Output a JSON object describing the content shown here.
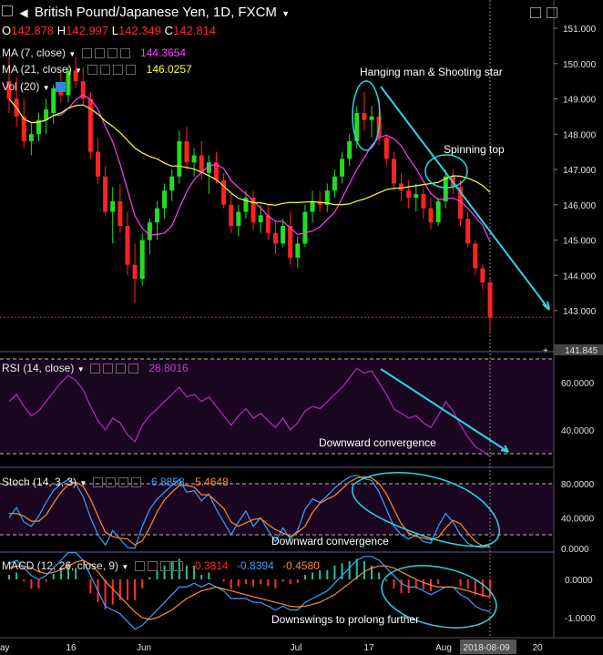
{
  "header": {
    "title": "British Pound/Japanese Yen, 1D, FXCM",
    "ohlc": {
      "o_label": "O",
      "o": "142.878",
      "h_label": "H",
      "h": "142.997",
      "l_label": "L",
      "l": "142.349",
      "c_label": "C",
      "c": "142.814"
    },
    "ma7": {
      "label": "MA (7, close)",
      "value": "144.3654"
    },
    "ma21": {
      "label": "MA (21, close)",
      "value": "146.0257"
    },
    "vol": {
      "label": "Vol (20)"
    }
  },
  "rsi": {
    "label": "RSI (14, close)",
    "value": "28.8016"
  },
  "stoch": {
    "label": "Stoch (14, 3, 3)",
    "k": "6.8858",
    "d": "5.4648"
  },
  "macd": {
    "label": "MACD (12, 26, close, 9)",
    "hist": "-0.3814",
    "macd": "-0.8394",
    "signal": "-0.4580"
  },
  "annotations": {
    "a1": "Hanging man & Shooting star",
    "a2": "Spinning top",
    "a3": "Downward convergence",
    "a4": "Downward convergence",
    "a5": "Downswings to prolong further"
  },
  "price_axis": {
    "ticks": [
      "151.000",
      "150.000",
      "149.000",
      "148.000",
      "147.000",
      "146.000",
      "145.000",
      "144.000",
      "143.000"
    ],
    "last": "141.845"
  },
  "rsi_axis": {
    "ticks": [
      "60.0000",
      "40.0000"
    ]
  },
  "stoch_axis": {
    "ticks": [
      "80.0000",
      "40.0000",
      "0.0000"
    ]
  },
  "macd_axis": {
    "ticks": [
      "0.0000",
      "-1.0000"
    ]
  },
  "time_axis": {
    "ticks": [
      "ay",
      "16",
      "Jun",
      "Jul",
      "17",
      "Aug",
      "2018-08-09",
      "20"
    ]
  },
  "colors": {
    "up": "#22dd22",
    "down": "#ff2222",
    "ma7": "#ff40ff",
    "ma21": "#ffff40",
    "rsi": "#b030c0",
    "stoch_k": "#3aa0ff",
    "stoch_d": "#ff8a30",
    "macd": "#3aa0ff",
    "signal": "#ff8a30",
    "annotation": "#2dd4e6"
  },
  "chart_data": {
    "type": "candlestick",
    "title": "British Pound/Japanese Yen, 1D, FXCM",
    "ylim": [
      141.845,
      151.4
    ],
    "candles": [
      [
        149.5,
        150.2,
        148.6,
        149.0
      ],
      [
        149.0,
        149.6,
        148.2,
        148.5
      ],
      [
        148.5,
        149.0,
        147.6,
        147.8
      ],
      [
        147.8,
        148.3,
        147.4,
        148.0
      ],
      [
        148.0,
        148.6,
        147.8,
        148.4
      ],
      [
        148.4,
        149.0,
        148.0,
        148.7
      ],
      [
        148.6,
        149.4,
        148.3,
        149.3
      ],
      [
        149.3,
        149.8,
        148.9,
        149.1
      ],
      [
        149.1,
        149.9,
        148.9,
        149.8
      ],
      [
        149.8,
        150.2,
        149.3,
        149.5
      ],
      [
        149.5,
        149.9,
        148.8,
        149.0
      ],
      [
        149.0,
        149.2,
        147.3,
        147.5
      ],
      [
        147.5,
        147.9,
        146.6,
        146.8
      ],
      [
        146.8,
        147.1,
        145.7,
        145.8
      ],
      [
        145.8,
        146.5,
        144.9,
        146.1
      ],
      [
        146.1,
        146.6,
        145.2,
        145.4
      ],
      [
        145.4,
        145.8,
        144.0,
        144.3
      ],
      [
        144.3,
        144.9,
        143.2,
        143.9
      ],
      [
        143.9,
        145.2,
        143.7,
        145.0
      ],
      [
        145.0,
        145.6,
        144.6,
        145.5
      ],
      [
        145.5,
        146.1,
        145.0,
        145.9
      ],
      [
        145.9,
        146.6,
        145.6,
        146.4
      ],
      [
        146.4,
        147.0,
        146.1,
        146.8
      ],
      [
        146.8,
        148.1,
        146.6,
        147.8
      ],
      [
        147.8,
        148.2,
        147.0,
        147.2
      ],
      [
        147.2,
        147.6,
        146.8,
        147.4
      ],
      [
        147.4,
        147.8,
        146.7,
        146.9
      ],
      [
        146.9,
        147.4,
        146.3,
        147.2
      ],
      [
        147.2,
        147.5,
        146.6,
        146.7
      ],
      [
        146.7,
        146.9,
        145.9,
        146.0
      ],
      [
        146.0,
        146.3,
        145.2,
        145.4
      ],
      [
        145.4,
        146.0,
        145.1,
        145.8
      ],
      [
        145.8,
        146.4,
        145.6,
        146.2
      ],
      [
        146.2,
        146.4,
        145.3,
        145.5
      ],
      [
        145.5,
        146.0,
        145.2,
        145.7
      ],
      [
        145.7,
        146.0,
        145.0,
        145.2
      ],
      [
        145.2,
        145.5,
        144.6,
        144.9
      ],
      [
        144.9,
        145.6,
        144.8,
        145.4
      ],
      [
        145.4,
        145.8,
        144.3,
        144.5
      ],
      [
        144.5,
        145.1,
        144.2,
        144.9
      ],
      [
        144.9,
        146.0,
        144.8,
        145.8
      ],
      [
        145.8,
        146.4,
        145.5,
        146.1
      ],
      [
        146.1,
        146.4,
        145.8,
        146.0
      ],
      [
        146.0,
        146.6,
        145.8,
        146.4
      ],
      [
        146.4,
        147.0,
        146.2,
        146.8
      ],
      [
        146.8,
        147.5,
        146.6,
        147.3
      ],
      [
        147.3,
        148.0,
        147.1,
        147.8
      ],
      [
        147.8,
        148.8,
        147.6,
        148.6
      ],
      [
        148.6,
        149.2,
        148.1,
        148.4
      ],
      [
        148.4,
        148.8,
        147.9,
        148.5
      ],
      [
        148.5,
        149.0,
        147.7,
        147.9
      ],
      [
        147.9,
        148.0,
        147.1,
        147.3
      ],
      [
        147.3,
        147.5,
        146.4,
        146.6
      ],
      [
        146.6,
        146.9,
        146.1,
        146.4
      ],
      [
        146.4,
        146.7,
        145.9,
        146.2
      ],
      [
        146.2,
        146.6,
        145.8,
        146.3
      ],
      [
        146.3,
        146.5,
        145.6,
        145.9
      ],
      [
        145.9,
        146.2,
        145.3,
        145.5
      ],
      [
        145.5,
        146.2,
        145.4,
        146.1
      ],
      [
        146.1,
        147.0,
        145.9,
        146.8
      ],
      [
        146.8,
        147.0,
        146.3,
        146.5
      ],
      [
        146.5,
        146.7,
        145.4,
        145.6
      ],
      [
        145.6,
        145.8,
        144.8,
        144.9
      ],
      [
        144.9,
        145.0,
        144.0,
        144.2
      ],
      [
        144.2,
        144.3,
        143.6,
        143.8
      ],
      [
        143.8,
        143.9,
        142.4,
        142.8
      ]
    ],
    "rsi": [
      52,
      55,
      50,
      46,
      48,
      52,
      56,
      60,
      63,
      61,
      57,
      50,
      44,
      40,
      45,
      43,
      38,
      35,
      42,
      46,
      49,
      52,
      55,
      58,
      54,
      55,
      52,
      54,
      50,
      46,
      42,
      46,
      49,
      45,
      47,
      44,
      41,
      45,
      40,
      43,
      48,
      50,
      49,
      52,
      55,
      58,
      62,
      66,
      64,
      65,
      60,
      55,
      49,
      47,
      45,
      46,
      43,
      41,
      46,
      52,
      48,
      42,
      37,
      33,
      31,
      28.8
    ],
    "stoch_k": [
      40,
      52,
      35,
      30,
      42,
      58,
      72,
      80,
      85,
      80,
      65,
      40,
      20,
      8,
      25,
      15,
      5,
      4,
      30,
      50,
      62,
      70,
      78,
      85,
      70,
      72,
      60,
      68,
      50,
      35,
      20,
      35,
      48,
      30,
      40,
      25,
      12,
      28,
      15,
      25,
      50,
      62,
      58,
      66,
      75,
      82,
      88,
      90,
      86,
      84,
      70,
      50,
      30,
      20,
      15,
      20,
      12,
      10,
      30,
      45,
      35,
      20,
      10,
      6,
      5,
      6.9
    ],
    "stoch_d": [
      45,
      45,
      42,
      36,
      36,
      43,
      57,
      70,
      79,
      82,
      77,
      62,
      42,
      23,
      18,
      16,
      15,
      8,
      13,
      28,
      47,
      61,
      70,
      78,
      78,
      76,
      67,
      67,
      59,
      51,
      35,
      30,
      34,
      38,
      39,
      32,
      26,
      22,
      18,
      23,
      30,
      46,
      57,
      62,
      66,
      74,
      82,
      87,
      88,
      87,
      80,
      68,
      50,
      33,
      22,
      18,
      16,
      14,
      17,
      28,
      37,
      33,
      22,
      12,
      7,
      5.5
    ],
    "macd": [
      0.4,
      0.5,
      0.3,
      0.1,
      0.0,
      0.1,
      0.3,
      0.5,
      0.7,
      0.7,
      0.5,
      0.1,
      -0.3,
      -0.7,
      -0.8,
      -0.9,
      -1.1,
      -1.3,
      -1.2,
      -1.0,
      -0.8,
      -0.6,
      -0.4,
      -0.2,
      -0.2,
      -0.1,
      -0.2,
      -0.1,
      -0.2,
      -0.3,
      -0.5,
      -0.5,
      -0.5,
      -0.6,
      -0.6,
      -0.7,
      -0.8,
      -0.7,
      -0.8,
      -0.8,
      -0.6,
      -0.5,
      -0.4,
      -0.3,
      -0.1,
      0.1,
      0.3,
      0.5,
      0.6,
      0.6,
      0.5,
      0.3,
      0.1,
      -0.1,
      -0.2,
      -0.2,
      -0.3,
      -0.4,
      -0.3,
      -0.2,
      -0.2,
      -0.4,
      -0.5,
      -0.7,
      -0.8,
      -0.84
    ],
    "signal": [
      0.3,
      0.35,
      0.35,
      0.3,
      0.2,
      0.15,
      0.18,
      0.25,
      0.35,
      0.45,
      0.5,
      0.4,
      0.2,
      -0.05,
      -0.25,
      -0.45,
      -0.65,
      -0.85,
      -1.0,
      -1.05,
      -1.0,
      -0.9,
      -0.8,
      -0.65,
      -0.5,
      -0.4,
      -0.3,
      -0.25,
      -0.2,
      -0.25,
      -0.3,
      -0.35,
      -0.4,
      -0.45,
      -0.5,
      -0.55,
      -0.6,
      -0.65,
      -0.7,
      -0.72,
      -0.7,
      -0.65,
      -0.6,
      -0.5,
      -0.4,
      -0.25,
      -0.1,
      0.05,
      0.2,
      0.3,
      0.35,
      0.35,
      0.3,
      0.2,
      0.1,
      0.0,
      -0.08,
      -0.15,
      -0.2,
      -0.2,
      -0.2,
      -0.25,
      -0.3,
      -0.36,
      -0.42,
      -0.458
    ]
  }
}
